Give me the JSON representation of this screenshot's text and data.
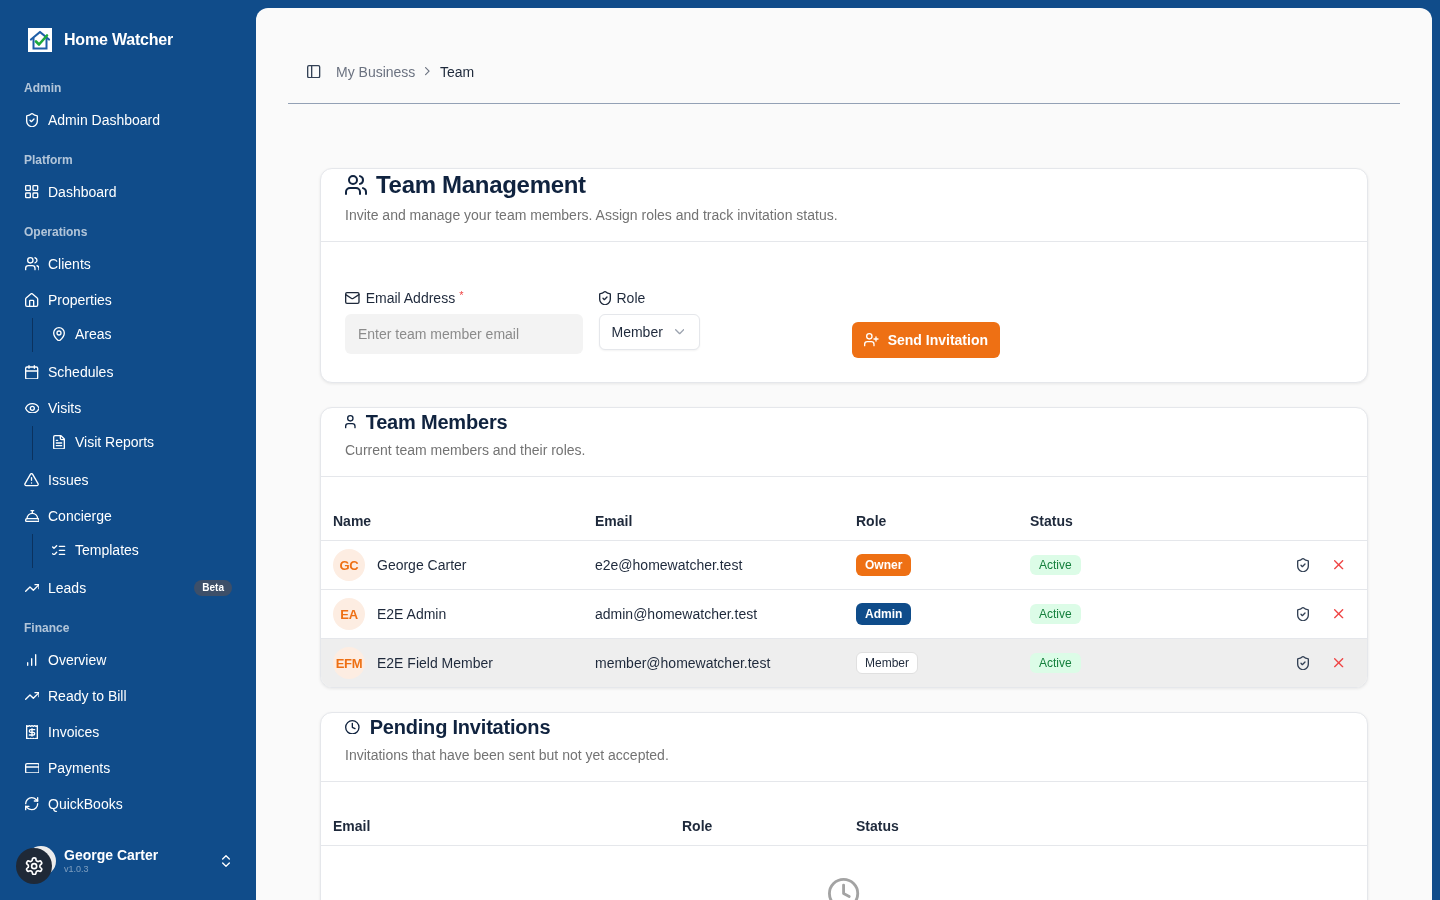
{
  "sidebar": {
    "brand": "Home Watcher",
    "groups": [
      {
        "label": "Admin",
        "items": [
          {
            "label": "Admin Dashboard"
          }
        ]
      },
      {
        "label": "Platform",
        "items": [
          {
            "label": "Dashboard"
          }
        ]
      },
      {
        "label": "Operations",
        "items": [
          {
            "label": "Clients"
          },
          {
            "label": "Properties",
            "children": [
              {
                "label": "Areas"
              }
            ]
          },
          {
            "label": "Schedules"
          },
          {
            "label": "Visits",
            "children": [
              {
                "label": "Visit Reports"
              }
            ]
          },
          {
            "label": "Issues"
          },
          {
            "label": "Concierge",
            "children": [
              {
                "label": "Templates"
              }
            ]
          },
          {
            "label": "Leads",
            "badge": "Beta"
          }
        ]
      },
      {
        "label": "Finance",
        "items": [
          {
            "label": "Overview"
          },
          {
            "label": "Ready to Bill"
          },
          {
            "label": "Invoices"
          },
          {
            "label": "Payments"
          },
          {
            "label": "QuickBooks"
          }
        ]
      }
    ],
    "user": {
      "name": "George Carter",
      "version": "v1.0.3"
    }
  },
  "breadcrumb": [
    {
      "label": "My Business",
      "current": false
    },
    {
      "label": "Team",
      "current": true
    }
  ],
  "team_management": {
    "title": "Team Management",
    "description": "Invite and manage your team members. Assign roles and track invitation status.",
    "email_field": {
      "label": "Email Address",
      "required_mark": "*",
      "placeholder": "Enter team member email"
    },
    "role_field": {
      "label": "Role",
      "value": "Member"
    },
    "submit_button": "Send Invitation"
  },
  "team_members": {
    "title": "Team Members",
    "description": "Current team members and their roles.",
    "columns": [
      "Name",
      "Email",
      "Role",
      "Status"
    ],
    "rows": [
      {
        "initials": "GC",
        "name": "George Carter",
        "email": "e2e@homewatcher.test",
        "role": {
          "text": "Owner",
          "kind": "accent"
        },
        "status": {
          "text": "Active",
          "kind": "success"
        },
        "highlighted": false
      },
      {
        "initials": "EA",
        "name": "E2E Admin",
        "email": "admin@homewatcher.test",
        "role": {
          "text": "Admin",
          "kind": "primary"
        },
        "status": {
          "text": "Active",
          "kind": "success"
        },
        "highlighted": false
      },
      {
        "initials": "EFM",
        "name": "E2E Field Member",
        "email": "member@homewatcher.test",
        "role": {
          "text": "Member",
          "kind": "outline"
        },
        "status": {
          "text": "Active",
          "kind": "success"
        },
        "highlighted": true
      }
    ]
  },
  "pending_invitations": {
    "title": "Pending Invitations",
    "description": "Invitations that have been sent but not yet accepted.",
    "columns": [
      "Email",
      "Role",
      "Status"
    ]
  }
}
